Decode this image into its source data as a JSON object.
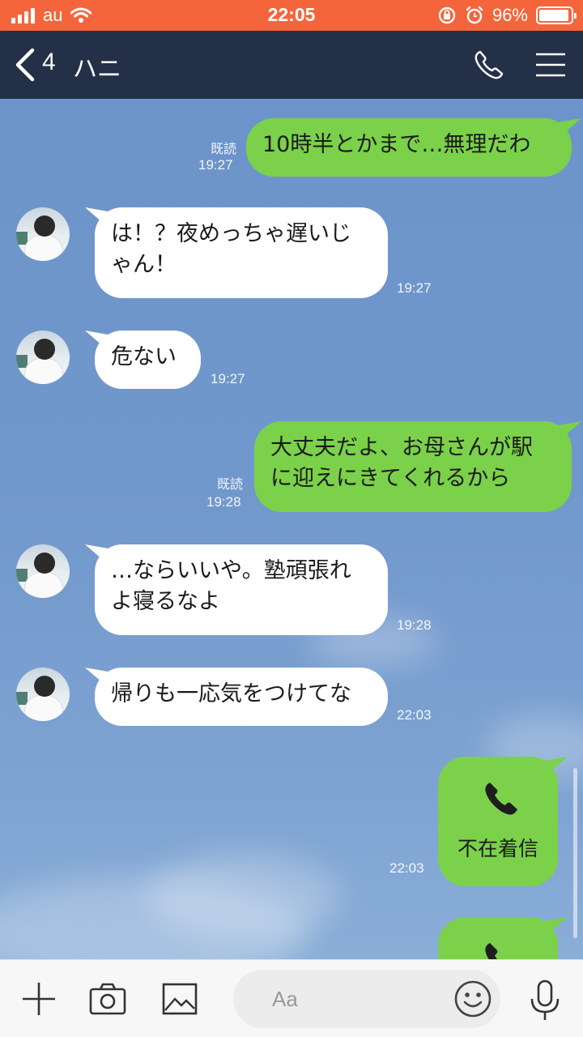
{
  "status_bar": {
    "carrier": "au",
    "time": "22:05",
    "battery_percent": "96%",
    "battery_level": 0.96,
    "icons": [
      "signal-icon",
      "wifi-icon",
      "rotation-lock-icon",
      "alarm-icon",
      "battery-icon"
    ]
  },
  "header": {
    "unread_count": "4",
    "title": "ハニ",
    "icons": [
      "back-chevron-icon",
      "phone-icon",
      "menu-icon"
    ]
  },
  "messages": [
    {
      "side": "out",
      "lines": [
        "10時半とかまで…無理だわ"
      ],
      "read": "既読",
      "time": "19:27"
    },
    {
      "side": "in",
      "lines": [
        "は！？夜めっちゃ遅いじ",
        "ゃん！"
      ],
      "time": "19:27"
    },
    {
      "side": "in",
      "lines": [
        "危ない"
      ],
      "time": "19:27"
    },
    {
      "side": "out",
      "lines": [
        "大丈夫だよ、お母さんが駅",
        "に迎えにきてくれるから"
      ],
      "read": "既読",
      "time": "19:28"
    },
    {
      "side": "in",
      "lines": [
        "…ならいいや。塾頑張れ",
        "よ寝るなよ"
      ],
      "time": "19:28"
    },
    {
      "side": "in",
      "lines": [
        "帰りも一応気をつけてな"
      ],
      "time": "22:03"
    },
    {
      "side": "out",
      "type": "missed-call",
      "label": "不在着信",
      "time": "22:03"
    }
  ],
  "input_bar": {
    "placeholder": "Aa",
    "icons": [
      "plus-icon",
      "camera-icon",
      "image-icon",
      "emoji-icon",
      "microphone-icon"
    ]
  },
  "colors": {
    "status_bar": "#f4653b",
    "header": "#243047",
    "outgoing_bubble": "#7bd14a",
    "incoming_bubble": "#ffffff",
    "chat_background": "#6f97cc"
  }
}
